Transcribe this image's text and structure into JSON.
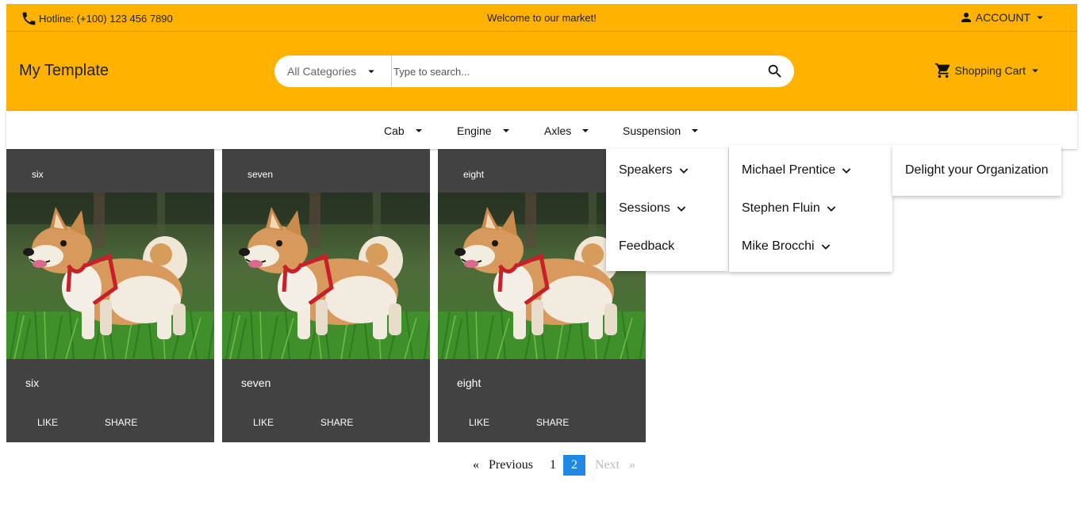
{
  "topbar": {
    "hotline": "Hotline: (+100) 123 456 7890",
    "welcome": "Welcome to our market!",
    "account": "ACCOUNT"
  },
  "header": {
    "brand": "My Template",
    "category": "All Categories",
    "search_placeholder": "Type to search...",
    "cart": "Shopping Cart"
  },
  "nav": {
    "items": [
      {
        "label": "Cab"
      },
      {
        "label": "Engine"
      },
      {
        "label": "Axles"
      },
      {
        "label": "Suspension"
      }
    ]
  },
  "cards": [
    {
      "header": "six",
      "title": "six",
      "like": "LIKE",
      "share": "SHARE"
    },
    {
      "header": "seven",
      "title": "seven",
      "like": "LIKE",
      "share": "SHARE"
    },
    {
      "header": "eight",
      "title": "eight",
      "like": "LIKE",
      "share": "SHARE"
    }
  ],
  "pagination": {
    "first": "«",
    "previous": "Previous",
    "pages": [
      "1",
      "2"
    ],
    "current": "2",
    "next": "Next",
    "last": "»"
  },
  "menus": {
    "level1": [
      "Speakers",
      "Sessions",
      "Feedback"
    ],
    "level2": [
      "Michael Prentice",
      "Stephen Fluin",
      "Mike Brocchi"
    ],
    "level3": [
      "Delight your Organization"
    ]
  },
  "colors": {
    "accent": "#ffb300",
    "card_bg": "#424242",
    "active_page": "#1e88e5"
  },
  "icons": {
    "hotline": "phone-icon",
    "account": "person-icon",
    "search": "search-icon",
    "cart": "shopping-cart-icon",
    "dropdown": "caret-down-icon",
    "submenu": "chevron-down-icon"
  }
}
